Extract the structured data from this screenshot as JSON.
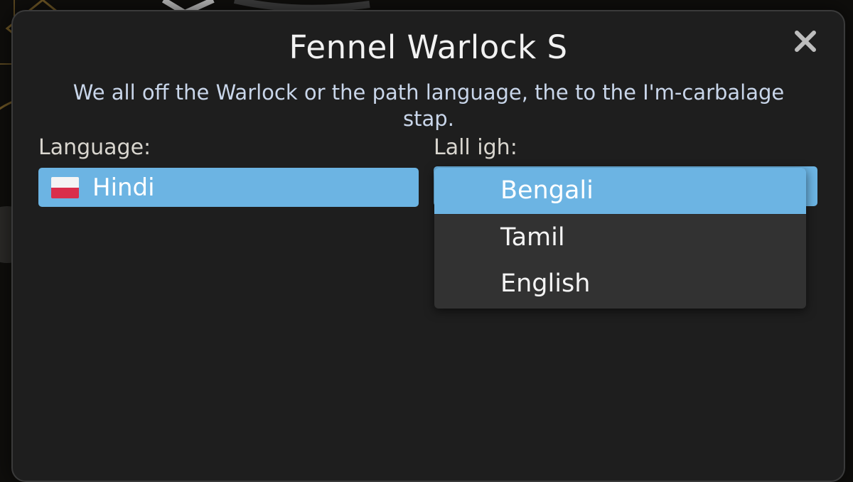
{
  "dialog": {
    "title": "Fennel Warlock S",
    "description": "We all off the Warlock or the path language, the to the I'm-carbalage stap.",
    "close_icon": "close-icon"
  },
  "left_field": {
    "label": "Language:",
    "value": "Hindi",
    "flag_icon": "flag-icon",
    "flag_colors": [
      "#f4f4f4",
      "#d92e4b"
    ]
  },
  "right_field": {
    "label": "Lall igh:",
    "options": [
      "Bengali",
      "Tamil",
      "English"
    ],
    "selected": "Bengali"
  },
  "colors": {
    "accent": "#6cb4e3",
    "dialog_bg": "#1e1e1e",
    "dropdown_bg": "#323232"
  }
}
